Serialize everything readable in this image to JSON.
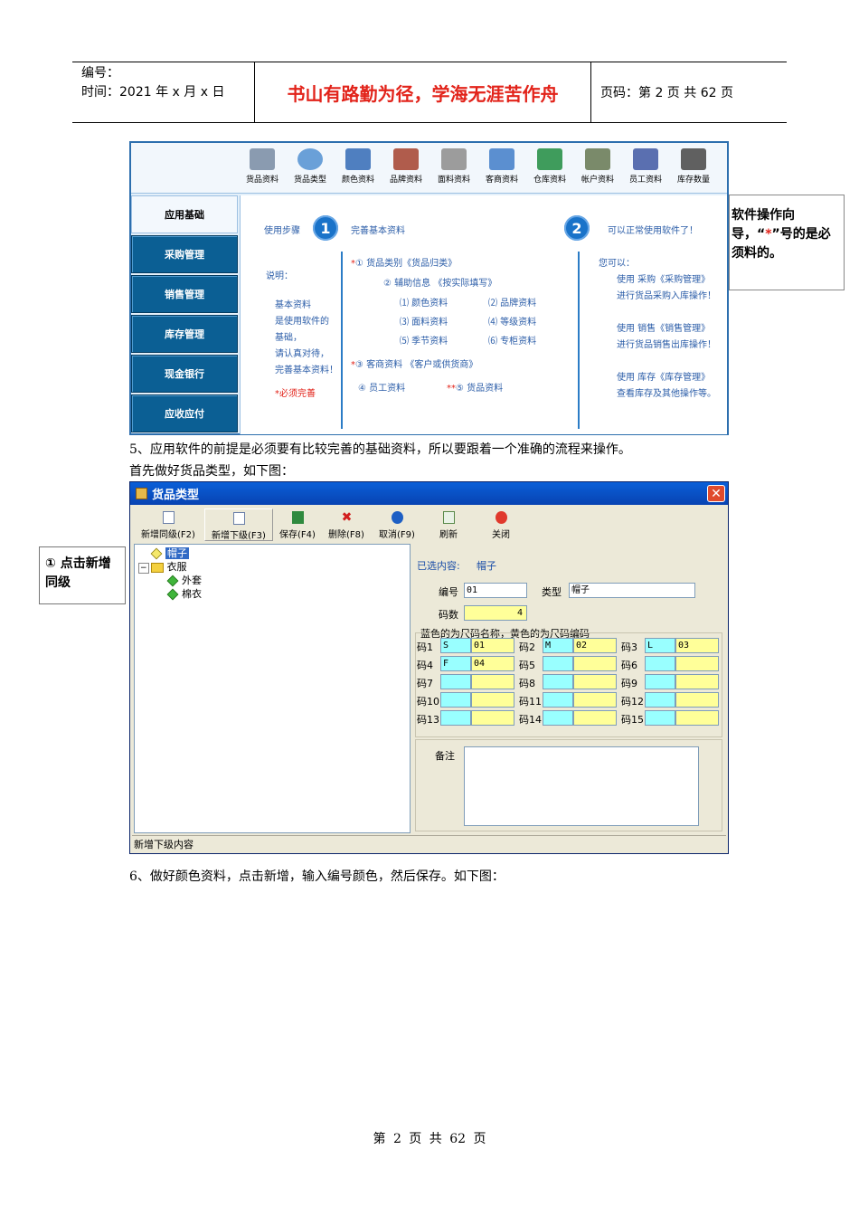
{
  "header": {
    "number_label": "编号：",
    "time_label": "时间：2021 年 x 月 x 日",
    "motto": "书山有路勤为径，学海无涯苦作舟",
    "page_info": "页码：第 2 页  共 62 页"
  },
  "screen1": {
    "toolbar": [
      "货品资料",
      "货品类型",
      "颜色资料",
      "品牌资料",
      "面料资料",
      "客商资料",
      "仓库资料",
      "帐户资料",
      "员工资料",
      "库存数量"
    ],
    "nav": [
      "应用基础",
      "采购管理",
      "销售管理",
      "库存管理",
      "现金银行",
      "应收应付"
    ],
    "steps_label": "使用步骤",
    "step1_num": "1",
    "step1_text": "完善基本资料",
    "step2_num": "2",
    "step2_text": "可以正常使用软件了！",
    "explain_label": "说明：",
    "explain_lines": [
      "基本资料",
      "是使用软件的",
      "基础，",
      "请认真对待，",
      "完善基本资料！"
    ],
    "required_note": "*必须完善",
    "items": {
      "i1": "① 货品类别《货品归类》",
      "i2": "② 辅助信息 《按实际填写》",
      "s1": "⑴ 颜色资料",
      "s2": "⑵ 品牌资料",
      "s3": "⑶ 面料资料",
      "s4": "⑷ 等级资料",
      "s5": "⑸ 季节资料",
      "s6": "⑹ 专柜资料",
      "i3": "③ 客商资料 《客户或供货商》",
      "i4": "④ 员工资料",
      "i5": "⑤ 货品资料"
    },
    "right_header": "您可以：",
    "right_lines": [
      "使用 采购《采购管理》",
      "进行货品采购入库操作！",
      "使用 销售《销售管理》",
      "进行货品销售出库操作！",
      "使用 库存《库存管理》",
      "查看库存及其他操作等。"
    ]
  },
  "callout1": {
    "pre": "软件操作向导，“",
    "star": "*",
    "post": "”号的是必须料的。"
  },
  "para5a": "5、应用软件的前提是必须要有比较完善的基础资料，所以要跟着一个准确的流程来操作。",
  "para5b": "首先做好货品类型，如下图：",
  "callout2": "① 点击新增同级",
  "screen2": {
    "title": "货品类型",
    "close": "✕",
    "toolbar": [
      "新增同级(F2)",
      "新增下级(F3)",
      "保存(F4)",
      "删除(F8)",
      "取消(F9)",
      "刷新",
      "关闭"
    ],
    "tree": {
      "n1": "帽子",
      "n2": "衣服",
      "n3": "外套",
      "n4": "棉衣"
    },
    "selected_label": "已选内容:",
    "selected_value": "帽子",
    "code_label": "编号",
    "code_value": "01",
    "type_label": "类型",
    "type_value": "帽子",
    "count_label": "码数",
    "count_value": "4",
    "size_group_title": "蓝色的为尺码名称，黄色的为尺码编码",
    "sizes": [
      {
        "label": "码1",
        "name": "S",
        "code": "01"
      },
      {
        "label": "码2",
        "name": "M",
        "code": "02"
      },
      {
        "label": "码3",
        "name": "L",
        "code": "03"
      },
      {
        "label": "码4",
        "name": "F",
        "code": "04"
      },
      {
        "label": "码5",
        "name": "",
        "code": ""
      },
      {
        "label": "码6",
        "name": "",
        "code": ""
      },
      {
        "label": "码7",
        "name": "",
        "code": ""
      },
      {
        "label": "码8",
        "name": "",
        "code": ""
      },
      {
        "label": "码9",
        "name": "",
        "code": ""
      },
      {
        "label": "码10",
        "name": "",
        "code": ""
      },
      {
        "label": "码11",
        "name": "",
        "code": ""
      },
      {
        "label": "码12",
        "name": "",
        "code": ""
      },
      {
        "label": "码13",
        "name": "",
        "code": ""
      },
      {
        "label": "码14",
        "name": "",
        "code": ""
      },
      {
        "label": "码15",
        "name": "",
        "code": ""
      }
    ],
    "remark_label": "备注",
    "status": "新增下级内容"
  },
  "para6": "6、做好颜色资料，点击新增，输入编号颜色，然后保存。如下图：",
  "footer": "第 2 页 共 62 页",
  "colors": {
    "motto": "#e2231a",
    "nav": "#0b5f94",
    "step_circle": "#1a73c9",
    "xp_title": "#0a5fd8"
  }
}
